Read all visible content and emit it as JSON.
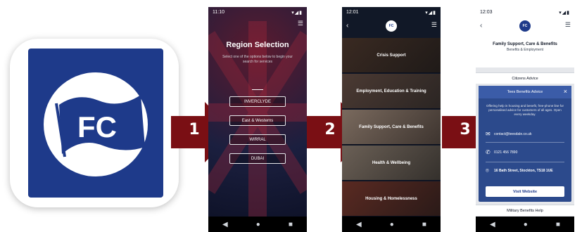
{
  "app_icon": {
    "text": "FC",
    "bg_color": "#1e3a8a"
  },
  "steps": [
    "1",
    "2",
    "3"
  ],
  "arrow_color": "#7a0f14",
  "phone1": {
    "status_time": "11:10",
    "status_icons": "▾◢▮",
    "title": "Region Selection",
    "subtitle": "Select one of the options below to begin your search for services",
    "regions": [
      "INVERCLYDE",
      "East & Westerns",
      "WIRRAL",
      "DUBAI"
    ],
    "nav": [
      "◀",
      "●",
      "■"
    ]
  },
  "phone2": {
    "status_time": "12:01",
    "status_icons": "▾◢▮",
    "logo": "FC",
    "categories": [
      "Crisis Support",
      "Employment, Education & Training",
      "Family Support, Care & Benefits",
      "Health & Wellbeing",
      "Housing & Homelessness"
    ],
    "nav": [
      "◀",
      "●",
      "■"
    ]
  },
  "phone3": {
    "status_time": "12:03",
    "status_icons": "▾◢▮",
    "logo": "FC",
    "title": "Family Support, Care & Benefits",
    "subtitle": "Benefits & Employment",
    "row_top": "Citizens Advice",
    "modal_title": "Tees Benefits Advice",
    "modal_body": "Offering help in housing and benefit, free-phone line for personalised advice for customers of all ages. Open every weekday.",
    "email": "contact@teesdale.co.uk",
    "phone": "0121 456 7890",
    "address": "16 Bath Street, Stockton, TS18 1UE",
    "visit_button": "Visit Website",
    "row_bottom": "Military Benefits Help",
    "nav": [
      "◀",
      "●",
      "■"
    ]
  }
}
